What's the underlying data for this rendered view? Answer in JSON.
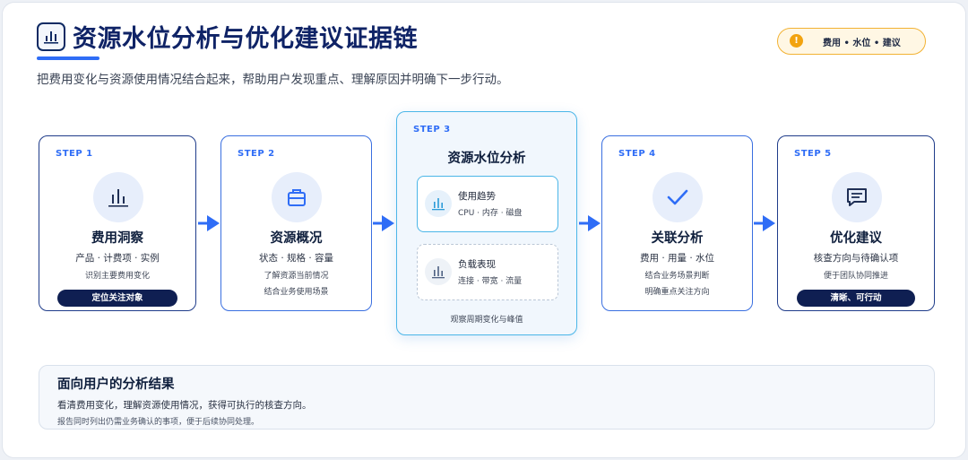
{
  "header": {
    "title": "资源水位分析与优化建议证据链",
    "subtitle": "把费用变化与资源使用情况结合起来，帮助用户发现重点、理解原因并明确下一步行动。",
    "tag": "费用 • 水位 • 建议",
    "tag_icon": "!"
  },
  "steps": [
    {
      "label": "STEP 1",
      "title": "费用洞察",
      "subtitle": "产品 · 计费项 · 实例",
      "note": "识别主要费用变化",
      "pill": "定位关注对象",
      "icon": "bar-chart-icon"
    },
    {
      "label": "STEP 2",
      "title": "资源概况",
      "subtitle": "状态 · 规格 · 容量",
      "notes": [
        "了解资源当前情况",
        "结合业务使用场景"
      ],
      "icon": "briefcase-icon"
    },
    {
      "label": "STEP 3",
      "title": "资源水位分析",
      "cards": [
        {
          "title": "使用趋势",
          "desc": "CPU · 内存 · 磁盘",
          "icon": "bar-chart-icon"
        },
        {
          "title": "负载表现",
          "desc": "连接 · 带宽 · 流量",
          "icon": "bar-chart-icon"
        }
      ],
      "note": "观察周期变化与峰值"
    },
    {
      "label": "STEP 4",
      "title": "关联分析",
      "subtitle": "费用 · 用量 · 水位",
      "notes": [
        "结合业务场景判断",
        "明确重点关注方向"
      ],
      "icon": "check-icon"
    },
    {
      "label": "STEP 5",
      "title": "优化建议",
      "subtitle": "核查方向与待确认项",
      "note": "便于团队协同推进",
      "pill": "清晰、可行动",
      "icon": "message-icon"
    }
  ],
  "result": {
    "title": "面向用户的分析结果",
    "line1": "看清费用变化，理解资源使用情况，获得可执行的核查方向。",
    "line2": "报告同时列出仍需业务确认的事项，便于后续协同处理。"
  },
  "colors": {
    "navy": "#0f1f52",
    "accent_blue": "#2f6df6",
    "cyan_border": "#4bb6e8",
    "tag_orange": "#f2a30f"
  }
}
